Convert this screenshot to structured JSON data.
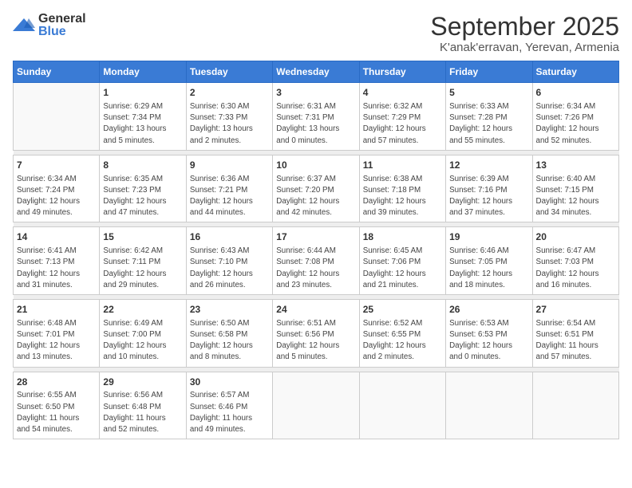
{
  "logo": {
    "general": "General",
    "blue": "Blue"
  },
  "header": {
    "month": "September 2025",
    "location": "K'anak'erravan, Yerevan, Armenia"
  },
  "weekdays": [
    "Sunday",
    "Monday",
    "Tuesday",
    "Wednesday",
    "Thursday",
    "Friday",
    "Saturday"
  ],
  "weeks": [
    [
      {
        "day": "",
        "info": ""
      },
      {
        "day": "1",
        "info": "Sunrise: 6:29 AM\nSunset: 7:34 PM\nDaylight: 13 hours\nand 5 minutes."
      },
      {
        "day": "2",
        "info": "Sunrise: 6:30 AM\nSunset: 7:33 PM\nDaylight: 13 hours\nand 2 minutes."
      },
      {
        "day": "3",
        "info": "Sunrise: 6:31 AM\nSunset: 7:31 PM\nDaylight: 13 hours\nand 0 minutes."
      },
      {
        "day": "4",
        "info": "Sunrise: 6:32 AM\nSunset: 7:29 PM\nDaylight: 12 hours\nand 57 minutes."
      },
      {
        "day": "5",
        "info": "Sunrise: 6:33 AM\nSunset: 7:28 PM\nDaylight: 12 hours\nand 55 minutes."
      },
      {
        "day": "6",
        "info": "Sunrise: 6:34 AM\nSunset: 7:26 PM\nDaylight: 12 hours\nand 52 minutes."
      }
    ],
    [
      {
        "day": "7",
        "info": "Sunrise: 6:34 AM\nSunset: 7:24 PM\nDaylight: 12 hours\nand 49 minutes."
      },
      {
        "day": "8",
        "info": "Sunrise: 6:35 AM\nSunset: 7:23 PM\nDaylight: 12 hours\nand 47 minutes."
      },
      {
        "day": "9",
        "info": "Sunrise: 6:36 AM\nSunset: 7:21 PM\nDaylight: 12 hours\nand 44 minutes."
      },
      {
        "day": "10",
        "info": "Sunrise: 6:37 AM\nSunset: 7:20 PM\nDaylight: 12 hours\nand 42 minutes."
      },
      {
        "day": "11",
        "info": "Sunrise: 6:38 AM\nSunset: 7:18 PM\nDaylight: 12 hours\nand 39 minutes."
      },
      {
        "day": "12",
        "info": "Sunrise: 6:39 AM\nSunset: 7:16 PM\nDaylight: 12 hours\nand 37 minutes."
      },
      {
        "day": "13",
        "info": "Sunrise: 6:40 AM\nSunset: 7:15 PM\nDaylight: 12 hours\nand 34 minutes."
      }
    ],
    [
      {
        "day": "14",
        "info": "Sunrise: 6:41 AM\nSunset: 7:13 PM\nDaylight: 12 hours\nand 31 minutes."
      },
      {
        "day": "15",
        "info": "Sunrise: 6:42 AM\nSunset: 7:11 PM\nDaylight: 12 hours\nand 29 minutes."
      },
      {
        "day": "16",
        "info": "Sunrise: 6:43 AM\nSunset: 7:10 PM\nDaylight: 12 hours\nand 26 minutes."
      },
      {
        "day": "17",
        "info": "Sunrise: 6:44 AM\nSunset: 7:08 PM\nDaylight: 12 hours\nand 23 minutes."
      },
      {
        "day": "18",
        "info": "Sunrise: 6:45 AM\nSunset: 7:06 PM\nDaylight: 12 hours\nand 21 minutes."
      },
      {
        "day": "19",
        "info": "Sunrise: 6:46 AM\nSunset: 7:05 PM\nDaylight: 12 hours\nand 18 minutes."
      },
      {
        "day": "20",
        "info": "Sunrise: 6:47 AM\nSunset: 7:03 PM\nDaylight: 12 hours\nand 16 minutes."
      }
    ],
    [
      {
        "day": "21",
        "info": "Sunrise: 6:48 AM\nSunset: 7:01 PM\nDaylight: 12 hours\nand 13 minutes."
      },
      {
        "day": "22",
        "info": "Sunrise: 6:49 AM\nSunset: 7:00 PM\nDaylight: 12 hours\nand 10 minutes."
      },
      {
        "day": "23",
        "info": "Sunrise: 6:50 AM\nSunset: 6:58 PM\nDaylight: 12 hours\nand 8 minutes."
      },
      {
        "day": "24",
        "info": "Sunrise: 6:51 AM\nSunset: 6:56 PM\nDaylight: 12 hours\nand 5 minutes."
      },
      {
        "day": "25",
        "info": "Sunrise: 6:52 AM\nSunset: 6:55 PM\nDaylight: 12 hours\nand 2 minutes."
      },
      {
        "day": "26",
        "info": "Sunrise: 6:53 AM\nSunset: 6:53 PM\nDaylight: 12 hours\nand 0 minutes."
      },
      {
        "day": "27",
        "info": "Sunrise: 6:54 AM\nSunset: 6:51 PM\nDaylight: 11 hours\nand 57 minutes."
      }
    ],
    [
      {
        "day": "28",
        "info": "Sunrise: 6:55 AM\nSunset: 6:50 PM\nDaylight: 11 hours\nand 54 minutes."
      },
      {
        "day": "29",
        "info": "Sunrise: 6:56 AM\nSunset: 6:48 PM\nDaylight: 11 hours\nand 52 minutes."
      },
      {
        "day": "30",
        "info": "Sunrise: 6:57 AM\nSunset: 6:46 PM\nDaylight: 11 hours\nand 49 minutes."
      },
      {
        "day": "",
        "info": ""
      },
      {
        "day": "",
        "info": ""
      },
      {
        "day": "",
        "info": ""
      },
      {
        "day": "",
        "info": ""
      }
    ]
  ]
}
